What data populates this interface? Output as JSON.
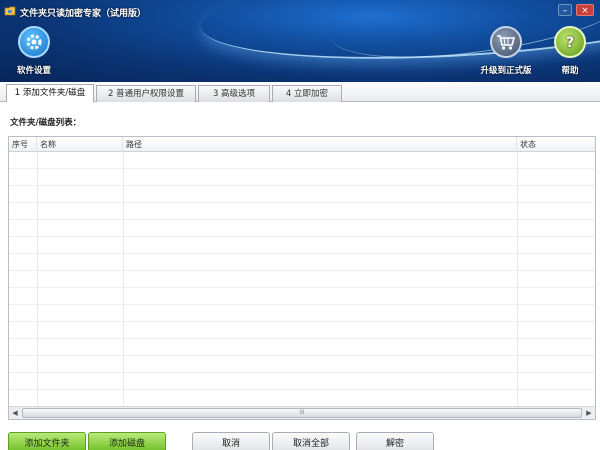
{
  "window": {
    "title": "文件夹只读加密专家（试用版）",
    "controls": {
      "minimize": "–",
      "close": "×"
    }
  },
  "toolbar": {
    "settings_label": "软件设置",
    "upgrade_label": "升级到正式版",
    "help_label": "帮助"
  },
  "tabs": [
    {
      "label": "1 添加文件夹/磁盘",
      "active": true
    },
    {
      "label": "2 普通用户权限设置",
      "active": false
    },
    {
      "label": "3 高级选项",
      "active": false
    },
    {
      "label": "4 立即加密",
      "active": false
    }
  ],
  "main": {
    "list_label": "文件夹/磁盘列表：",
    "table": {
      "columns": [
        "序号",
        "名称",
        "路径",
        "状态"
      ],
      "rows": []
    },
    "scrollbar_grip": "III"
  },
  "buttons": {
    "add_folder": "添加文件夹",
    "add_disk": "添加磁盘",
    "cancel": "取消",
    "cancel_all": "取消全部",
    "decrypt": "解密"
  },
  "colors": {
    "header_bg": "#0b3474",
    "accent_green": "#6bbc22"
  }
}
